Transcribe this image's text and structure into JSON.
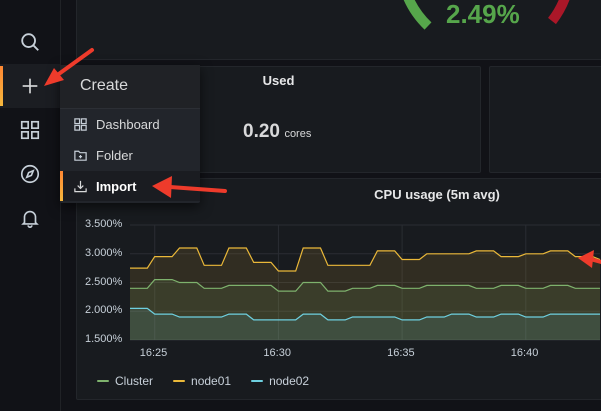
{
  "create_menu": {
    "header": "Create",
    "items": [
      {
        "label": "Dashboard",
        "icon": "dashboard-grid-icon"
      },
      {
        "label": "Folder",
        "icon": "folder-plus-icon"
      },
      {
        "label": "Import",
        "icon": "import-icon"
      }
    ]
  },
  "gauge": {
    "value": "2.49%",
    "color": "#56a64b"
  },
  "used_panel": {
    "title": "Used",
    "value": "0.20",
    "unit": "cores"
  },
  "cpu_panel": {
    "title": "CPU usage (5m avg)",
    "y_ticks": [
      "3.500%",
      "3.000%",
      "2.500%",
      "2.000%",
      "1.500%"
    ],
    "x_ticks": [
      "16:25",
      "16:30",
      "16:35",
      "16:40"
    ],
    "legend": [
      {
        "name": "Cluster",
        "color": "#7eb26d"
      },
      {
        "name": "node01",
        "color": "#eab839"
      },
      {
        "name": "node02",
        "color": "#6ed0e0"
      }
    ]
  },
  "sidebar_icons": [
    "search-icon",
    "plus-icon",
    "dashboards-icon",
    "explore-compass-icon",
    "alerting-bell-icon"
  ],
  "chart_data": {
    "type": "area",
    "title": "CPU usage (5m avg)",
    "ylim": [
      1.5,
      3.5
    ],
    "x_ticks": [
      "16:25",
      "16:30",
      "16:35",
      "16:40"
    ],
    "x": [
      "16:24",
      "16:25",
      "16:26",
      "16:27",
      "16:28",
      "16:29",
      "16:30",
      "16:31",
      "16:32",
      "16:33",
      "16:34",
      "16:35",
      "16:36",
      "16:37",
      "16:38",
      "16:39",
      "16:40",
      "16:41",
      "16:42",
      "16:43"
    ],
    "series": [
      {
        "name": "node01",
        "color": "#eab839",
        "values": [
          2.75,
          2.95,
          3.1,
          2.8,
          3.1,
          2.85,
          2.7,
          3.1,
          2.8,
          2.8,
          3.05,
          2.9,
          3.0,
          3.0,
          3.05,
          2.95,
          3.0,
          3.05,
          2.95,
          2.9
        ]
      },
      {
        "name": "Cluster",
        "color": "#7eb26d",
        "values": [
          2.4,
          2.55,
          2.5,
          2.4,
          2.45,
          2.45,
          2.35,
          2.5,
          2.35,
          2.4,
          2.45,
          2.4,
          2.45,
          2.45,
          2.4,
          2.45,
          2.4,
          2.45,
          2.4,
          2.4
        ]
      },
      {
        "name": "node02",
        "color": "#6ed0e0",
        "values": [
          2.05,
          1.95,
          1.9,
          1.9,
          1.95,
          1.85,
          1.85,
          1.95,
          1.85,
          1.9,
          1.9,
          1.85,
          1.9,
          1.95,
          1.9,
          1.95,
          1.9,
          1.95,
          1.95,
          1.95
        ]
      }
    ]
  }
}
